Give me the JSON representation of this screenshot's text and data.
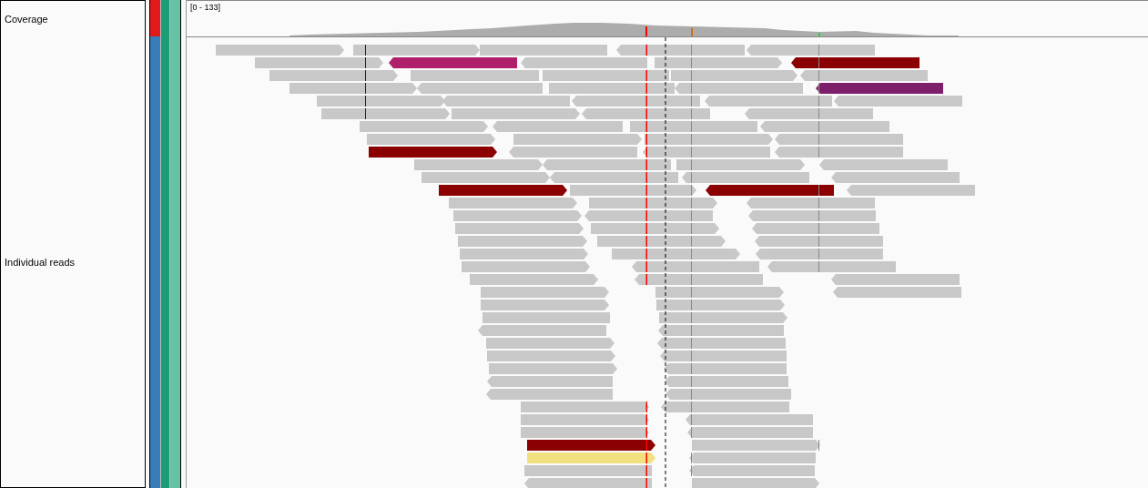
{
  "tracks": [
    {
      "label": "Coverage"
    },
    {
      "label": "Individual reads"
    }
  ],
  "coverage": {
    "range": "[0 - 133]"
  }
}
